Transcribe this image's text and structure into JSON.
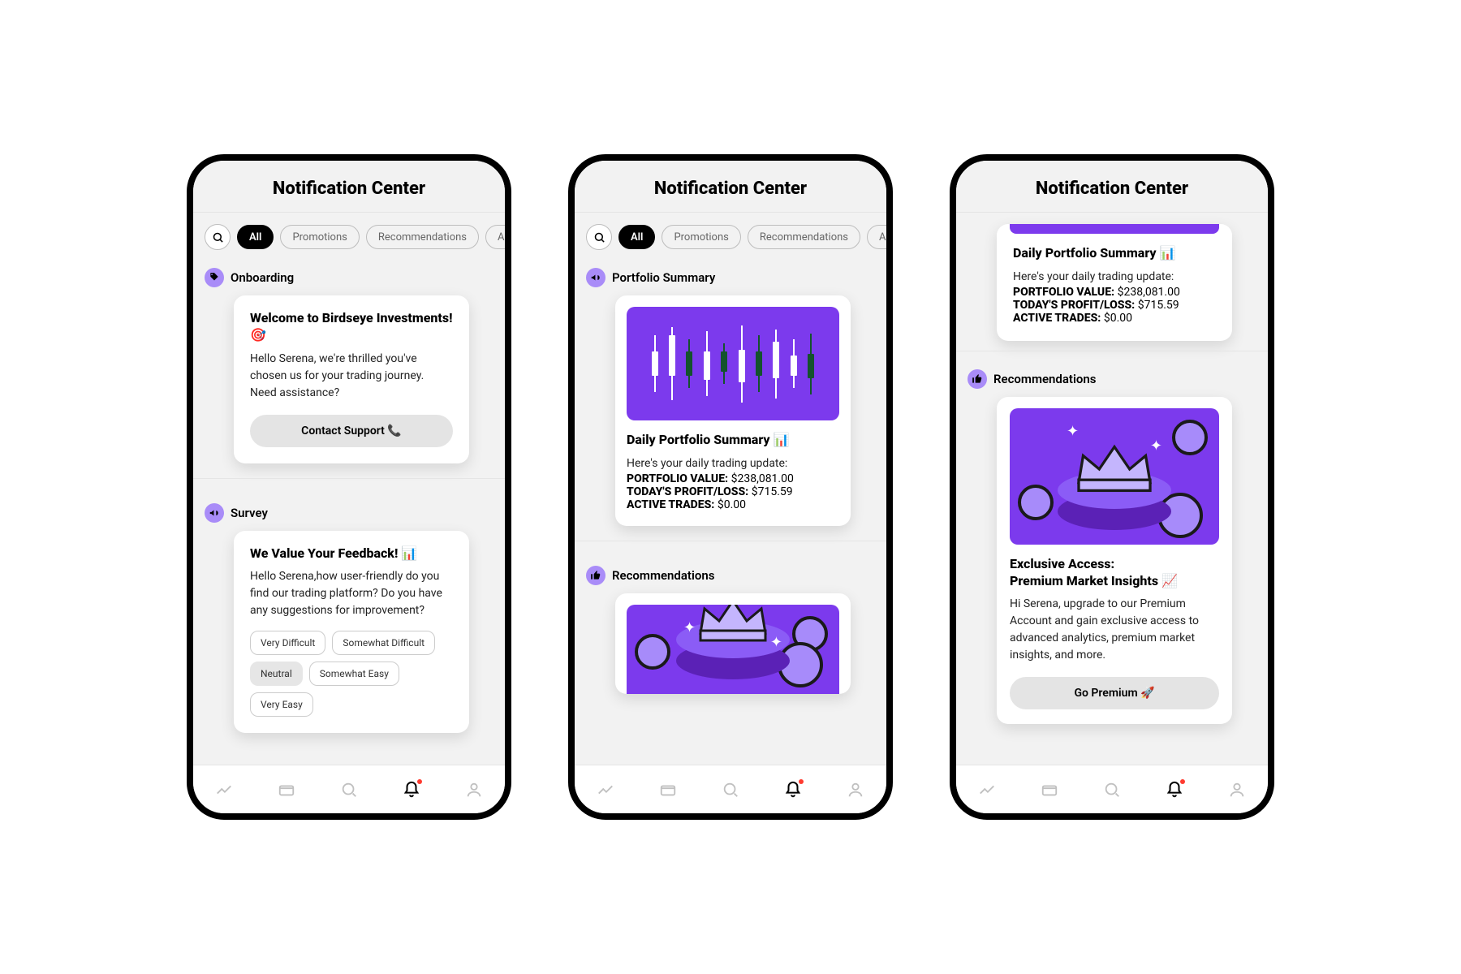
{
  "header_title": "Notification Center",
  "tabs": [
    "All",
    "Promotions",
    "Recommendations",
    "An"
  ],
  "sections": {
    "onboarding": "Onboarding",
    "survey": "Survey",
    "portfolio": "Portfolio Summary",
    "recommendations": "Recommendations"
  },
  "onboarding_card": {
    "title": "Welcome to Birdseye Investments! 🎯",
    "body": "Hello Serena, we're thrilled you've chosen us for your trading journey. Need assistance?",
    "button": "Contact Support 📞"
  },
  "survey_card": {
    "title": "We Value Your Feedback! 📊",
    "body": "Hello Serena,how user-friendly do you find our trading platform? Do you have any suggestions for improvement?",
    "options": [
      "Very Difficult",
      "Somewhat Difficult",
      "Neutral",
      "Somewhat Easy",
      "Very Easy"
    ],
    "selected": "Neutral"
  },
  "portfolio_card": {
    "title": "Daily Portfolio Summary 📊",
    "intro": "Here's your daily trading update:",
    "lines": {
      "value_label": "PORTFOLIO VALUE:",
      "value": " $238,081.00",
      "pl_label": "TODAY'S PROFIT/LOSS:",
      "pl": " $715.59",
      "trades_label": "ACTIVE TRADES:",
      "trades": " $0.00"
    }
  },
  "premium_card": {
    "title_line1": "Exclusive Access:",
    "title_line2": "Premium Market Insights 📈",
    "body": "Hi Serena, upgrade to our Premium Account and gain exclusive access to advanced analytics, premium market insights, and more.",
    "button": "Go Premium 🚀"
  }
}
